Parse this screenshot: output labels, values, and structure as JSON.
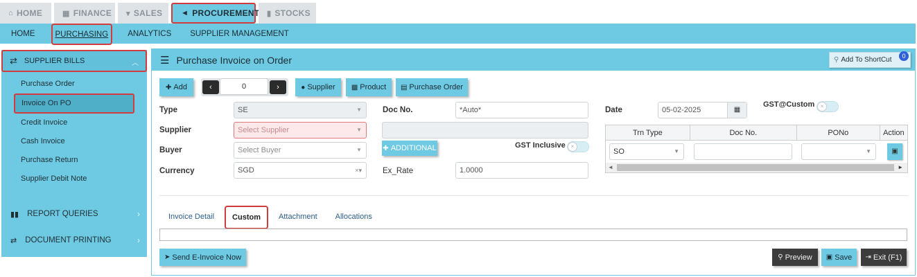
{
  "top_tabs": [
    {
      "icon": "home-icon",
      "glyph": "⌂",
      "label": "HOME"
    },
    {
      "icon": "bank-icon",
      "glyph": "▦",
      "label": "FINANCE"
    },
    {
      "icon": "cart-icon",
      "glyph": "▾",
      "label": "SALES"
    },
    {
      "icon": "megaphone-icon",
      "glyph": "◄",
      "label": "PROCUREMENT"
    },
    {
      "icon": "bar-chart-icon",
      "glyph": "▮",
      "label": "STOCKS"
    }
  ],
  "sub_nav": [
    "HOME",
    "PURCHASING",
    "ANALYTICS",
    "SUPPLIER MANAGEMENT"
  ],
  "sidebar": {
    "header": "SUPPLIER BILLS",
    "items": [
      "Purchase Order",
      "Invoice On PO",
      "Credit Invoice",
      "Cash Invoice",
      "Purchase Return",
      "Supplier Debit Note"
    ],
    "sections": [
      "REPORT QUERIES",
      "DOCUMENT PRINTING"
    ]
  },
  "panel": {
    "title": "Purchase Invoice on Order",
    "shortcut_label": "Add To ShortCut",
    "shortcut_count": "0"
  },
  "toolbar": {
    "add": "Add",
    "page_value": "0",
    "supplier": "Supplier",
    "product": "Product",
    "purchase_order": "Purchase Order"
  },
  "form": {
    "type_label": "Type",
    "type_value": "SE",
    "supplier_label": "Supplier",
    "supplier_placeholder": "Select Supplier",
    "buyer_label": "Buyer",
    "buyer_placeholder": "Select Buyer",
    "currency_label": "Currency",
    "currency_value": "SGD",
    "docno_label": "Doc No.",
    "docno_value": "*Auto*",
    "additional": "ADDITIONAL",
    "gst_inclusive_label": "GST Inclusive",
    "exrate_label": "Ex_Rate",
    "exrate_value": "1.0000",
    "date_label": "Date",
    "date_value": "05-02-2025",
    "gst_custom_label": "GST@Custom"
  },
  "grid": {
    "columns": [
      "Trn Type",
      "Doc No.",
      "PONo",
      "Action"
    ],
    "row": {
      "trn_type": "SO",
      "doc_no": "",
      "pono": ""
    }
  },
  "tabs": [
    "Invoice Detail",
    "Custom",
    "Attachment",
    "Allocations"
  ],
  "footer": {
    "send_einvoice": "Send E-Invoice Now",
    "preview": "Preview",
    "save": "Save",
    "exit": "Exit (F1)"
  }
}
